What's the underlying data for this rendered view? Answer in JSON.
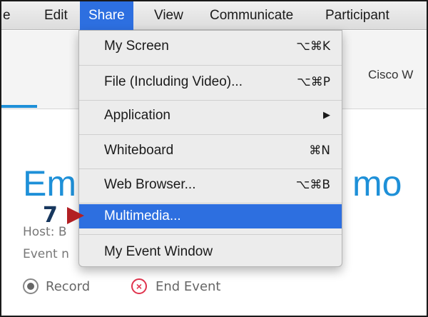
{
  "menubar": {
    "items": [
      {
        "label": "e",
        "active": false
      },
      {
        "label": "Edit",
        "active": false
      },
      {
        "label": "Share",
        "active": true
      },
      {
        "label": "View",
        "active": false
      },
      {
        "label": "Communicate",
        "active": false
      },
      {
        "label": "Participant",
        "active": false
      }
    ]
  },
  "window": {
    "brand_text": "Cisco W",
    "title_left": "Eml",
    "title_right": "mo",
    "host_label": "Host: B",
    "event_label": "Event n",
    "record_label": "Record",
    "end_event_label": "End Event"
  },
  "share_menu": {
    "items": [
      {
        "label": "My Screen",
        "shortcut": "⌥⌘K"
      },
      {
        "label": "File (Including Video)...",
        "shortcut": "⌥⌘P"
      },
      {
        "label": "Application",
        "shortcut": "▶"
      },
      {
        "label": "Whiteboard",
        "shortcut": "⌘N"
      },
      {
        "label": "Web Browser...",
        "shortcut": "⌥⌘B"
      },
      {
        "label": "Multimedia...",
        "shortcut": "",
        "highlighted": true
      },
      {
        "label": "My Event Window",
        "shortcut": ""
      }
    ]
  },
  "annotation": {
    "step_number": "7",
    "arrow_color": "#b21f24",
    "number_color": "#17375e"
  },
  "colors": {
    "accent": "#2d6fe0",
    "title_blue": "#1e90d8",
    "end_red": "#e0334d"
  },
  "icons": {
    "record": "record-radio-icon",
    "end_event": "circle-x-icon",
    "submenu": "triangle-right-icon"
  }
}
